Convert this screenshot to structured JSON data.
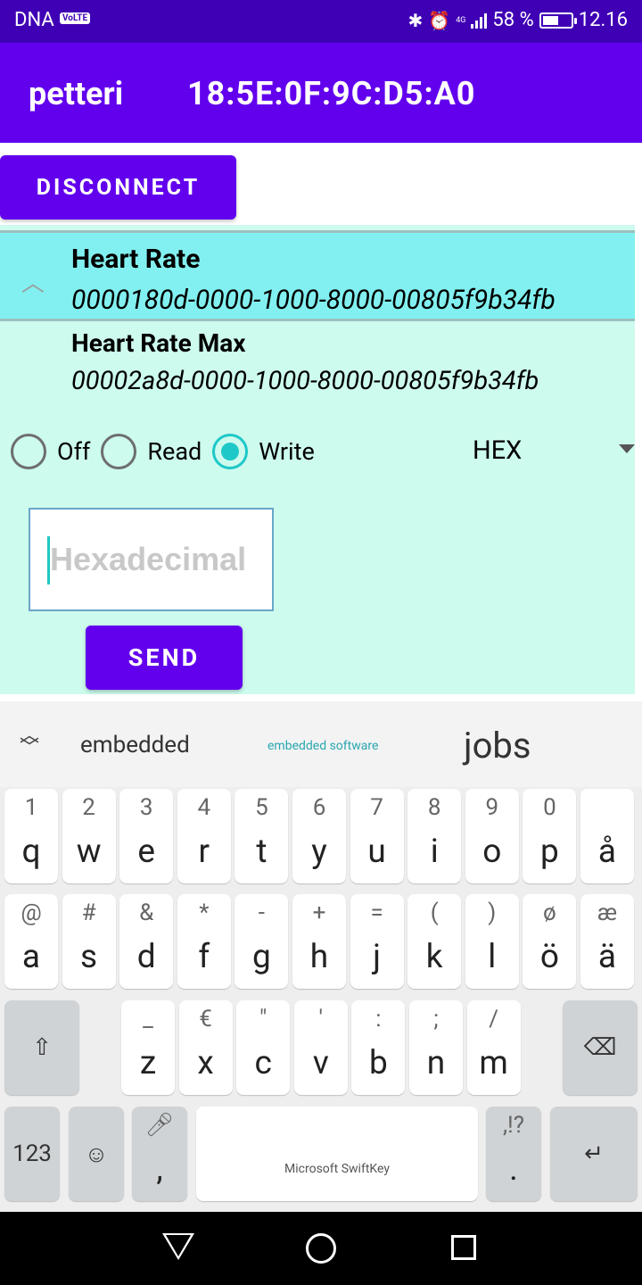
{
  "status_bar": {
    "carrier": "DNA",
    "volte": "VoLTE",
    "network": "4G",
    "battery": "58 %",
    "battery_level": 0.58,
    "time": "12.16"
  },
  "app_bar": {
    "device_name": "petteri",
    "mac_address": "18:5E:0F:9C:D5:A0"
  },
  "actions": {
    "disconnect_label": "DISCONNECT",
    "send_label": "SEND"
  },
  "service": {
    "name": "Heart Rate",
    "uuid": "0000180d-0000-1000-8000-00805f9b34fb"
  },
  "characteristic": {
    "name": "Heart Rate Max",
    "uuid": "00002a8d-0000-1000-8000-00805f9b34fb"
  },
  "mode_options": [
    {
      "label": "Off",
      "checked": false
    },
    {
      "label": "Read",
      "checked": false
    },
    {
      "label": "Write",
      "checked": true
    }
  ],
  "format_select": {
    "selected": "HEX"
  },
  "value_input": {
    "placeholder": "Hexadecimal",
    "value": ""
  },
  "keyboard": {
    "suggestions": [
      "embedded",
      "embedded software",
      "jobs"
    ],
    "row1": [
      {
        "alt": "1",
        "main": "q"
      },
      {
        "alt": "2",
        "main": "w"
      },
      {
        "alt": "3",
        "main": "e"
      },
      {
        "alt": "4",
        "main": "r"
      },
      {
        "alt": "5",
        "main": "t"
      },
      {
        "alt": "6",
        "main": "y"
      },
      {
        "alt": "7",
        "main": "u"
      },
      {
        "alt": "8",
        "main": "i"
      },
      {
        "alt": "9",
        "main": "o"
      },
      {
        "alt": "0",
        "main": "p"
      },
      {
        "alt": "",
        "main": "å"
      }
    ],
    "row2": [
      {
        "alt": "@",
        "main": "a"
      },
      {
        "alt": "#",
        "main": "s"
      },
      {
        "alt": "&",
        "main": "d"
      },
      {
        "alt": "*",
        "main": "f"
      },
      {
        "alt": "-",
        "main": "g"
      },
      {
        "alt": "+",
        "main": "h"
      },
      {
        "alt": "=",
        "main": "j"
      },
      {
        "alt": "(",
        "main": "k"
      },
      {
        "alt": ")",
        "main": "l"
      },
      {
        "alt": "ø",
        "main": "ö"
      },
      {
        "alt": "æ",
        "main": "ä"
      }
    ],
    "row3": [
      {
        "alt": "_",
        "main": "z"
      },
      {
        "alt": "€",
        "main": "x"
      },
      {
        "alt": "\"",
        "main": "c"
      },
      {
        "alt": "'",
        "main": "v"
      },
      {
        "alt": ":",
        "main": "b"
      },
      {
        "alt": ";",
        "main": "n"
      },
      {
        "alt": "/",
        "main": "m"
      }
    ],
    "numbers_key": "123",
    "comma_key": ",",
    "period_key": ".",
    "period_alt": ",!?",
    "space_label": "Microsoft SwiftKey"
  }
}
